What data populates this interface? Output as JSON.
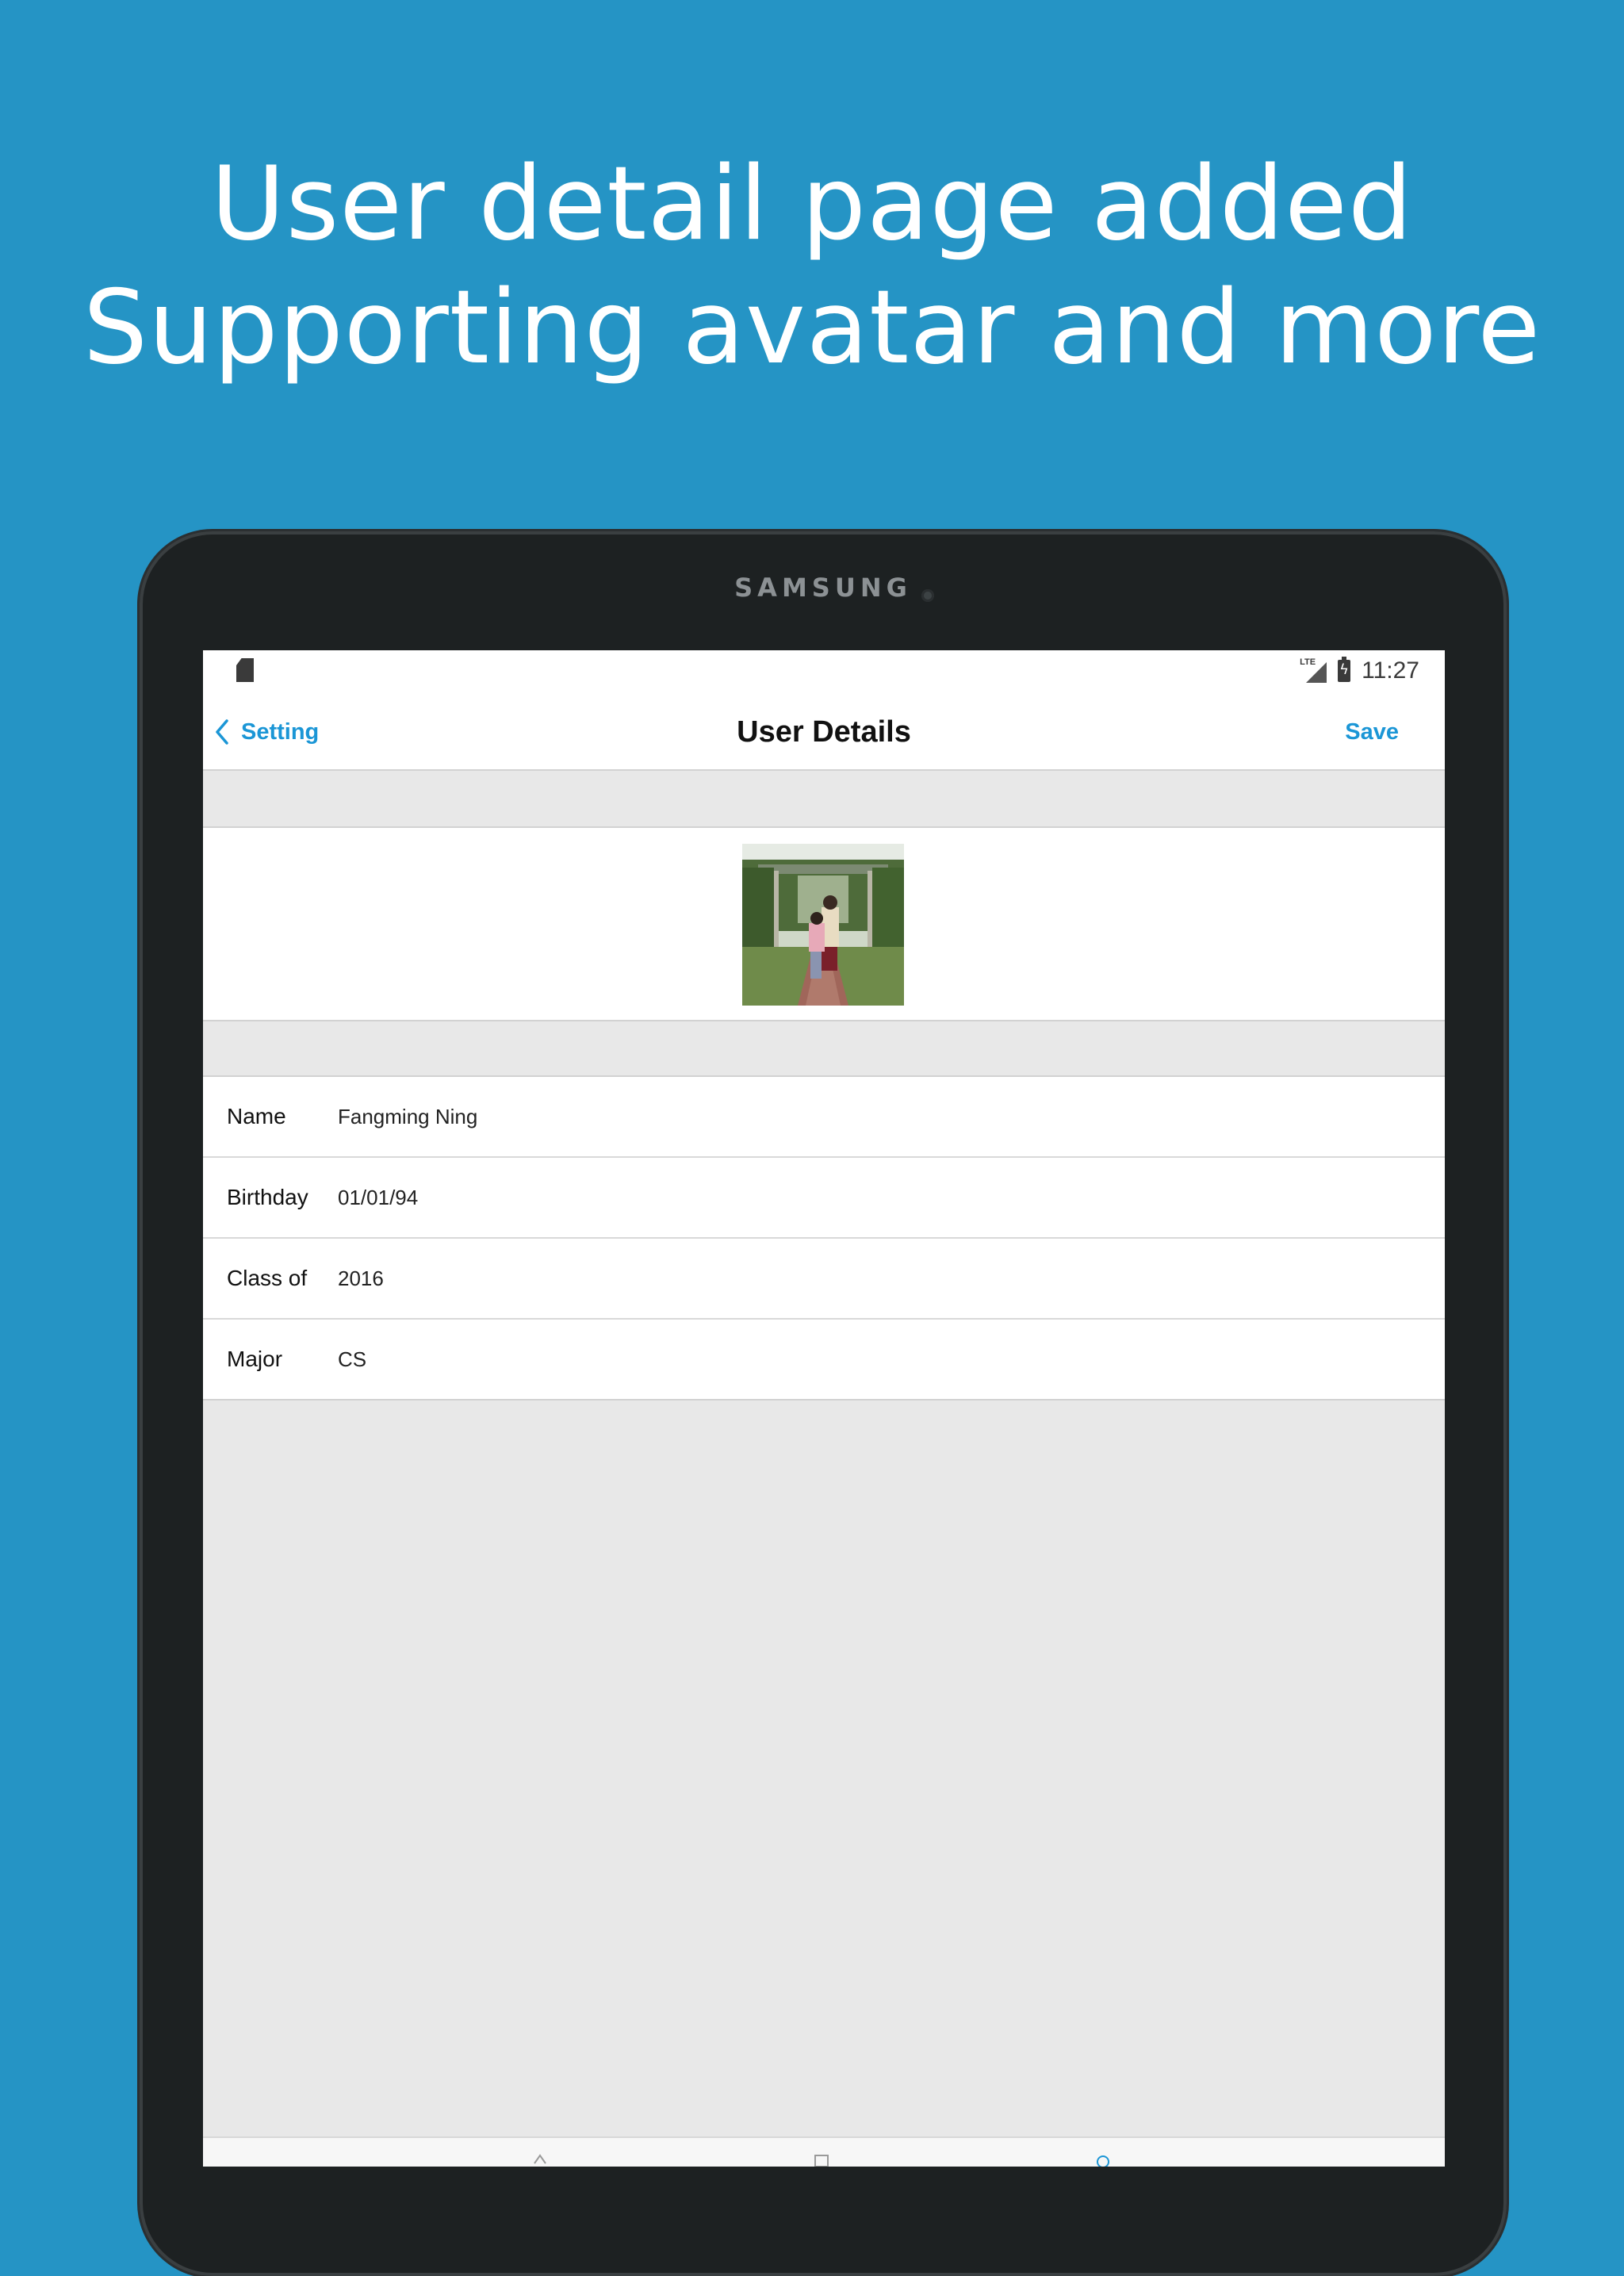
{
  "headline": {
    "line1": "User detail page added",
    "line2": "Supporting avatar and more"
  },
  "device": {
    "brand": "SAMSUNG"
  },
  "status_bar": {
    "network": "LTE",
    "time": "11:27"
  },
  "nav": {
    "back_label": "Setting",
    "title": "User Details",
    "save_label": "Save"
  },
  "avatar": {
    "alt": "User avatar photo"
  },
  "form": {
    "rows": [
      {
        "label": "Name",
        "value": "Fangming Ning"
      },
      {
        "label": "Birthday",
        "value": "01/01/94"
      },
      {
        "label": "Class of",
        "value": "2016"
      },
      {
        "label": "Major",
        "value": "CS"
      }
    ]
  },
  "colors": {
    "background": "#2594c5",
    "accent": "#1b96d6",
    "device": "#1d2122"
  },
  "icons": [
    "sd-card-icon",
    "signal-icon",
    "battery-charging-icon",
    "chevron-left-icon"
  ]
}
